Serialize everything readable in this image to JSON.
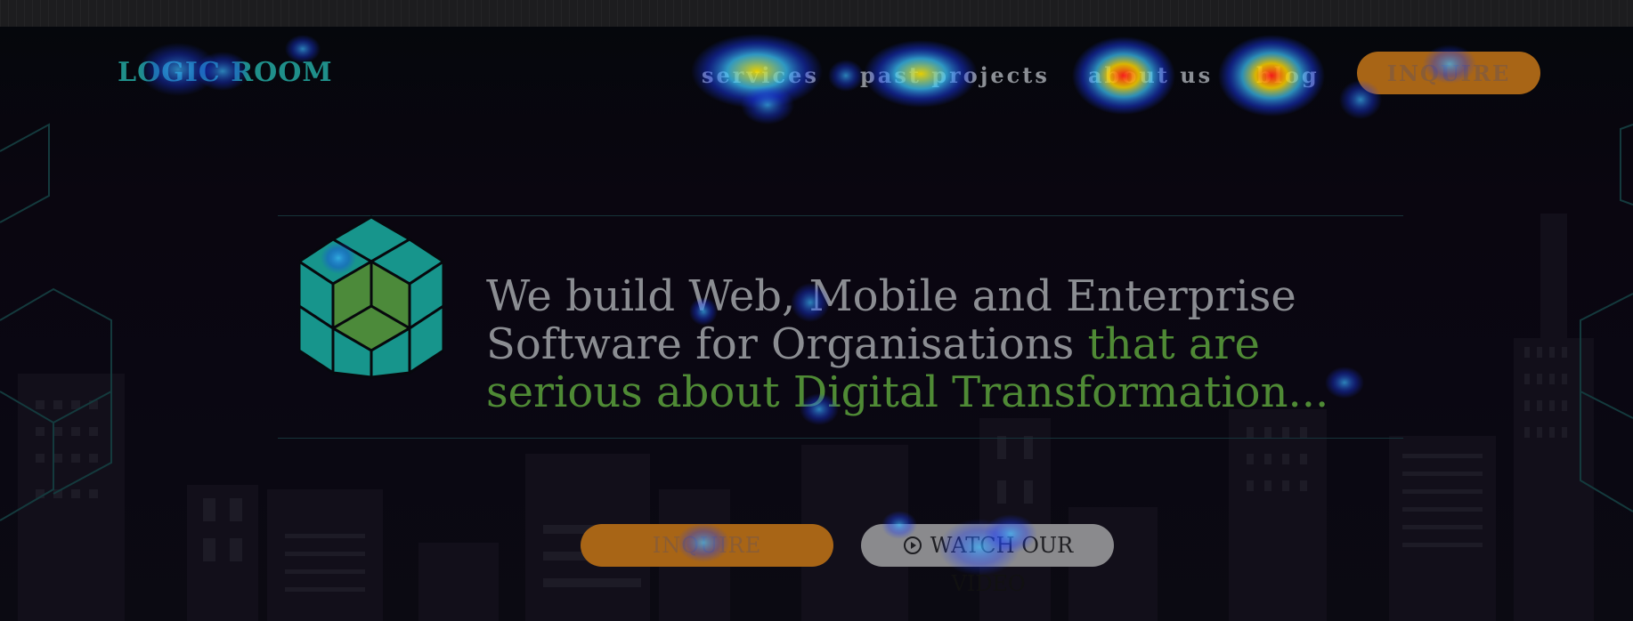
{
  "nav": {
    "logo": "LOGIC ROOM",
    "links": [
      "services",
      "past projects",
      "about us",
      "blog"
    ],
    "cta": "INQUIRE"
  },
  "hero": {
    "headline_plain": "We build Web, Mobile and Enterprise Software for Organisations ",
    "headline_accent": "that are serious about Digital Transformation...",
    "primary_button": "INQUIRE",
    "secondary_button": "WATCH OUR",
    "secondary_button_line2": "VIDEO"
  },
  "colors": {
    "brand_teal": "#1f8f8a",
    "accent_green": "#4f8a35",
    "cta_orange": "#a86516",
    "background": "#07070d"
  },
  "icons": {
    "logo": "cube-logo-icon",
    "video": "play-circle-icon"
  }
}
